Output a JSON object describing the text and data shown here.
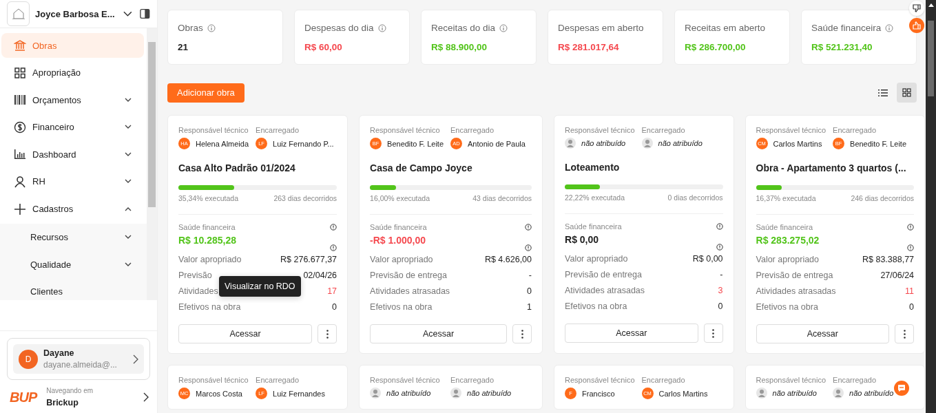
{
  "sidebar": {
    "company": "Joyce Barbosa E...",
    "menu": [
      {
        "kind": "bank",
        "label": "Obras",
        "selected": true,
        "chevron": false
      },
      {
        "kind": "grid",
        "label": "Apropriação",
        "selected": false,
        "chevron": false
      },
      {
        "kind": "barcode",
        "label": "Orçamentos",
        "selected": false,
        "chevron": true,
        "expanded": false
      },
      {
        "kind": "dollar",
        "label": "Financeiro",
        "selected": false,
        "chevron": true,
        "expanded": false
      },
      {
        "kind": "chart",
        "label": "Dashboard",
        "selected": false,
        "chevron": true,
        "expanded": false
      },
      {
        "kind": "person",
        "label": "RH",
        "selected": false,
        "chevron": true,
        "expanded": false
      },
      {
        "kind": "plus",
        "label": "Cadastros",
        "selected": false,
        "chevron": true,
        "expanded": true,
        "children": [
          {
            "label": "Recursos",
            "chevron": true
          },
          {
            "label": "Qualidade",
            "chevron": true
          },
          {
            "label": "Clientes",
            "chevron": false
          }
        ]
      }
    ],
    "user": {
      "initial": "D",
      "name": "Dayane",
      "email": "dayane.almeida@..."
    },
    "workspace": {
      "logo": "BUP",
      "caption": "Navegando em",
      "name": "Brickup"
    }
  },
  "stats": [
    {
      "label": "Obras",
      "info": true,
      "value": "21",
      "color": "#222222"
    },
    {
      "label": "Despesas do dia",
      "info": true,
      "value": "R$ 60,00",
      "color": "#f5484e"
    },
    {
      "label": "Receitas do dia",
      "info": true,
      "value": "R$ 88.900,00",
      "color": "#52c41a"
    },
    {
      "label": "Despesas em aberto",
      "info": false,
      "value": "R$ 281.017,64",
      "color": "#f5484e"
    },
    {
      "label": "Receitas em aberto",
      "info": false,
      "value": "R$ 286.700,00",
      "color": "#52c41a"
    },
    {
      "label": "Saúde financeira",
      "info": true,
      "value": "R$ 521.231,40",
      "color": "#52c41a"
    }
  ],
  "add_button": "Adicionar obra",
  "view_toggle": [
    {
      "kind": "list",
      "selected": false
    },
    {
      "kind": "grid",
      "selected": true
    }
  ],
  "cards": [
    {
      "people": [
        {
          "label": "Responsável técnico",
          "initials": "HA",
          "name": "Helena Almeida",
          "assigned": true
        },
        {
          "label": "Encarregado",
          "initials": "LF",
          "name": "Luiz Fernando P...",
          "assigned": true
        }
      ],
      "title": "Casa Alto Padrão 01/2024",
      "level": 0.3534,
      "executed": "35,34% executada",
      "days": "263 dias decorridos",
      "health_label": "Saúde financeira",
      "health": "R$ 10.285,28",
      "color": "#52c41a",
      "rows": [
        {
          "label": "Valor apropriado",
          "value": "R$ 276.677,37"
        },
        {
          "label": "Previsão",
          "value": "02/04/26"
        },
        {
          "label": "Atividades",
          "value": "17",
          "alert": true
        },
        {
          "label": "Efetivos na obra",
          "value": "0"
        }
      ],
      "button": "Acessar",
      "tooltip": "Visualizar no RDO"
    },
    {
      "people": [
        {
          "label": "Responsável técnico",
          "initials": "BF",
          "name": "Benedito F. Leite",
          "assigned": true
        },
        {
          "label": "Encarregado",
          "initials": "AD",
          "name": "Antonio de Paula",
          "assigned": true
        }
      ],
      "title": "Casa de Campo Joyce",
      "level": 0.16,
      "executed": "16,00% executada",
      "days": "43 dias decorridos",
      "health_label": "Saúde financeira",
      "health": "-R$ 1.000,00",
      "color": "#f5484e",
      "rows": [
        {
          "label": "Valor apropriado",
          "value": "R$ 4.626,00"
        },
        {
          "label": "Previsão de entrega",
          "value": "-"
        },
        {
          "label": "Atividades atrasadas",
          "value": "0",
          "alert": false
        },
        {
          "label": "Efetivos na obra",
          "value": "1"
        }
      ],
      "button": "Acessar"
    },
    {
      "people": [
        {
          "label": "Responsável técnico",
          "name": "não atribuído",
          "assigned": false
        },
        {
          "label": "Encarregado",
          "name": "não atribuído",
          "assigned": false
        }
      ],
      "title": "Loteamento",
      "level": 0.2222,
      "executed": "22,22% executada",
      "days": "0 dias decorridos",
      "health_label": "Saúde financeira",
      "health": "R$ 0,00",
      "color": "#222222",
      "rows": [
        {
          "label": "Valor apropriado",
          "value": "R$ 0,00"
        },
        {
          "label": "Previsão de entrega",
          "value": "-"
        },
        {
          "label": "Atividades atrasadas",
          "value": "3",
          "alert": true
        },
        {
          "label": "Efetivos na obra",
          "value": "0"
        }
      ],
      "button": "Acessar"
    },
    {
      "people": [
        {
          "label": "Responsável técnico",
          "initials": "CM",
          "name": "Carlos Martins",
          "assigned": true
        },
        {
          "label": "Encarregado",
          "initials": "BF",
          "name": "Benedito F. Leite",
          "assigned": true
        }
      ],
      "title": "Obra - Apartamento 3 quartos (...",
      "level": 0.1637,
      "executed": "16,37% executada",
      "days": "246 dias decorridos",
      "health_label": "Saúde financeira",
      "health": "R$ 283.275,02",
      "color": "#52c41a",
      "rows": [
        {
          "label": "Valor apropriado",
          "value": "R$ 83.388,77"
        },
        {
          "label": "Previsão de entrega",
          "value": "27/06/24"
        },
        {
          "label": "Atividades atrasadas",
          "value": "11",
          "alert": true
        },
        {
          "label": "Efetivos na obra",
          "value": "0"
        }
      ],
      "button": "Acessar"
    }
  ],
  "cards_below": [
    {
      "people": [
        {
          "label": "Responsável técnico",
          "initials": "MC",
          "name": "Marcos Costa",
          "assigned": true
        },
        {
          "label": "Encarregado",
          "initials": "LF",
          "name": "Luiz Fernandes",
          "assigned": true
        }
      ]
    },
    {
      "people": [
        {
          "label": "Responsável técnico",
          "name": "não atribuído",
          "assigned": false
        },
        {
          "label": "Encarregado",
          "name": "não atribuído",
          "assigned": false
        }
      ]
    },
    {
      "people": [
        {
          "label": "Responsável técnico",
          "initials": "F",
          "name": "Francisco",
          "assigned": true
        },
        {
          "label": "Encarregado",
          "initials": "CM",
          "name": "Carlos Martins",
          "assigned": true
        }
      ]
    },
    {
      "people": [
        {
          "label": "Responsável técnico",
          "name": "não atribuído",
          "assigned": false
        },
        {
          "label": "Encarregado",
          "name": "não atribuído",
          "assigned": false
        }
      ]
    }
  ]
}
